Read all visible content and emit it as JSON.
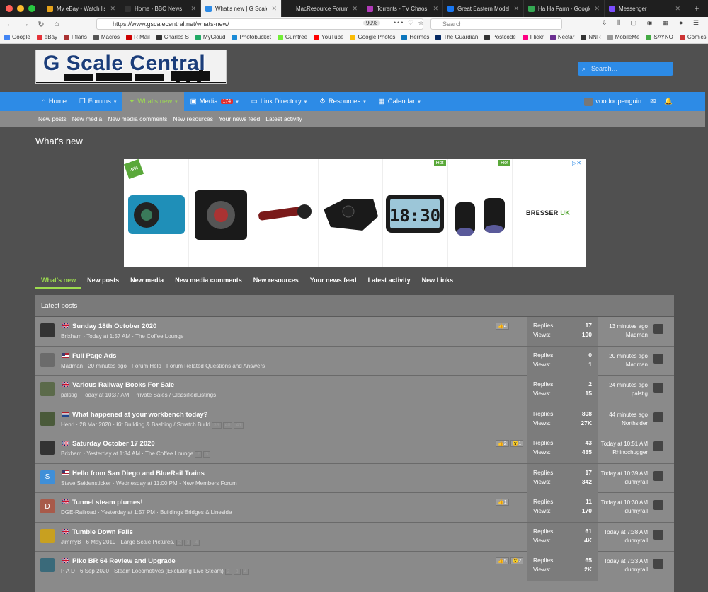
{
  "browser": {
    "tabs": [
      {
        "label": "My eBay - Watch list",
        "color": "#e5a21b",
        "active": false
      },
      {
        "label": "Home - BBC News",
        "color": "#333333",
        "active": false
      },
      {
        "label": "What's new | G Scale C…",
        "color": "#2d8be6",
        "active": true
      },
      {
        "label": "MacResource Forums :: Tip…",
        "color": "#1f1f1f",
        "active": false
      },
      {
        "label": "Torrents - TV Chaos UK",
        "color": "#b13ab8",
        "active": false
      },
      {
        "label": "Great Eastern Model Ra…",
        "color": "#1877f2",
        "active": false
      },
      {
        "label": "Ha Ha Farm - Google M…",
        "color": "#34a853",
        "active": false
      },
      {
        "label": "Messenger",
        "color": "#7b4dff",
        "active": false
      }
    ],
    "url": "https://www.gscalecentral.net/whats-new/",
    "zoom": "90%",
    "search_placeholder": "Search",
    "bookmarks": [
      {
        "label": "Google",
        "color": "#4285f4"
      },
      {
        "label": "eBay",
        "color": "#e53238"
      },
      {
        "label": "Fflans",
        "color": "#a33"
      },
      {
        "label": "Macros",
        "color": "#555"
      },
      {
        "label": "R Mail",
        "color": "#c00"
      },
      {
        "label": "Charles S",
        "color": "#333"
      },
      {
        "label": "MyCloud",
        "color": "#2a6"
      },
      {
        "label": "Photobucket",
        "color": "#1a8ad6"
      },
      {
        "label": "Gumtree",
        "color": "#72ef36"
      },
      {
        "label": "YouTube",
        "color": "#f00"
      },
      {
        "label": "Google Photos",
        "color": "#fbbc04"
      },
      {
        "label": "Hermes",
        "color": "#0a75bc"
      },
      {
        "label": "The Guardian",
        "color": "#052962"
      },
      {
        "label": "Postcode",
        "color": "#333"
      },
      {
        "label": "Flickr",
        "color": "#ff0084"
      },
      {
        "label": "Nectar",
        "color": "#6b2f91"
      },
      {
        "label": "NNR",
        "color": "#333"
      },
      {
        "label": "MobileMe",
        "color": "#999"
      },
      {
        "label": "SAYNO",
        "color": "#4a4"
      },
      {
        "label": "ComicsPriceGuide.c…",
        "color": "#c33"
      }
    ]
  },
  "site": {
    "logo_text": "G Scale Central",
    "search_placeholder": "Search…",
    "nav": [
      {
        "label": "Home",
        "icon": "home-icon"
      },
      {
        "label": "Forums",
        "icon": "forums-icon"
      },
      {
        "label": "What's new",
        "icon": "bulb-icon"
      },
      {
        "label": "Media",
        "icon": "media-icon",
        "badge": "174"
      },
      {
        "label": "Link Directory",
        "icon": "folder-icon"
      },
      {
        "label": "Resources",
        "icon": "resources-icon"
      },
      {
        "label": "Calendar",
        "icon": "calendar-icon"
      }
    ],
    "username": "voodoopenguin",
    "subnav": [
      "New posts",
      "New media",
      "New media comments",
      "New resources",
      "Your news feed",
      "Latest activity"
    ],
    "page_title": "What's new",
    "ad": {
      "sale_label": "-6%",
      "hot_label": "Hot",
      "brand": "BRESSER",
      "brand_suffix": "UK"
    },
    "tabs": [
      "What's new",
      "New posts",
      "New media",
      "New media comments",
      "New resources",
      "Your news feed",
      "Latest activity",
      "New Links"
    ],
    "block_title": "Latest posts",
    "replies_label": "Replies:",
    "views_label": "Views:",
    "threads": [
      {
        "title": "Sunday 18th October 2020",
        "flag": "uk",
        "meta": "Brixham · Today at 1:57 AM · The Coffee Lounge",
        "pages": [],
        "badges": [
          "👍4"
        ],
        "replies": "17",
        "views": "100",
        "last_time": "13 minutes ago",
        "last_user": "Madman",
        "avatar_color": "#333"
      },
      {
        "title": "Full Page Ads",
        "flag": "us",
        "meta": "Madman · 20 minutes ago · Forum Help · Forum Related Questions and Answers",
        "pages": [],
        "badges": [],
        "replies": "0",
        "views": "1",
        "last_time": "20 minutes ago",
        "last_user": "Madman",
        "avatar_color": "#6b6b6b"
      },
      {
        "title": "Various Railway Books For Sale",
        "flag": "uk",
        "meta": "palstig · Today at 10:37 AM · Private Sales / ClassifiedListings",
        "pages": [],
        "badges": [],
        "replies": "2",
        "views": "15",
        "last_time": "24 minutes ago",
        "last_user": "palstig",
        "avatar_color": "#5b6a4a"
      },
      {
        "title": "What happened at your workbench today?",
        "flag": "nl",
        "meta": "Henri · 28 Mar 2020 · Kit Building & Bashing / Scratch Build",
        "pages": [
          "39",
          "40",
          "41"
        ],
        "badges": [],
        "replies": "808",
        "views": "27K",
        "last_time": "44 minutes ago",
        "last_user": "Northsider",
        "avatar_color": "#4a5a3a"
      },
      {
        "title": "Saturday October 17 2020",
        "flag": "uk",
        "meta": "Brixham · Yesterday at 1:34 AM · The Coffee Lounge",
        "pages": [
          "2",
          "3"
        ],
        "badges": [
          "👍2",
          "😮1"
        ],
        "replies": "43",
        "views": "485",
        "last_time": "Today at 10:51 AM",
        "last_user": "Rhinochugger",
        "avatar_color": "#333"
      },
      {
        "title": "Hello from San Diego and BlueRail Trains",
        "flag": "us",
        "meta": "Steve Seidensticker · Wednesday at 11:00 PM · New Members Forum",
        "pages": [],
        "badges": [],
        "replies": "17",
        "views": "342",
        "last_time": "Today at 10:39 AM",
        "last_user": "dunnyrail",
        "avatar_color": "#3f8fd8",
        "avatar_letter": "S"
      },
      {
        "title": "Tunnel steam plumes!",
        "flag": "uk",
        "meta": "DGE-Railroad · Yesterday at 1:57 PM · Buildings Bridges & Lineside",
        "pages": [],
        "badges": [
          "👍1"
        ],
        "replies": "11",
        "views": "170",
        "last_time": "Today at 10:30 AM",
        "last_user": "dunnyrail",
        "avatar_color": "#a85a4a",
        "avatar_letter": "D"
      },
      {
        "title": "Tumble Down Falls",
        "flag": "uk",
        "meta": "JimmyB · 6 May 2019 · Large Scale Pictures.",
        "pages": [
          "2",
          "3",
          "4"
        ],
        "badges": [],
        "replies": "61",
        "views": "4K",
        "last_time": "Today at 7:38 AM",
        "last_user": "dunnyrail",
        "avatar_color": "#c8a020"
      },
      {
        "title": "Piko BR 64 Review and Upgrade",
        "flag": "uk",
        "meta": "P A D · 6 Sep 2020 · Steam Locomotives (Excluding Live Steam)",
        "pages": [
          "2",
          "3",
          "4"
        ],
        "badges": [
          "👍5",
          "😮2"
        ],
        "replies": "65",
        "views": "2K",
        "last_time": "Today at 7:33 AM",
        "last_user": "dunnyrail",
        "avatar_color": "#3a6a7a"
      }
    ]
  }
}
